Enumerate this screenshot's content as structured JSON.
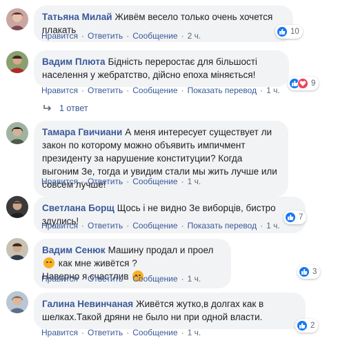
{
  "actions": {
    "like": "Нравится",
    "reply": "Ответить",
    "message": "Сообщение",
    "translate": "Показать перевод"
  },
  "colors": {
    "author": "#385898",
    "bubble": "#f2f3f5",
    "like": "#1877f2",
    "love": "#f33e58"
  },
  "comments": [
    {
      "author": "Татьяна Милай",
      "text": "Живём весело только очень хочется плакать",
      "time": "2 ч.",
      "reactions": "10"
    },
    {
      "author": "Вадим Плюта",
      "text": "Бідність переростає для більшості населення у жебратство, дійсно епоха міняється!",
      "time": "1 ч.",
      "reactions": "9"
    },
    {
      "author": "Тамара Гвичиани",
      "text": "А меня интересует существует ли закон по которому можно объявить импичмент президенту за нарушение конституции? Когда выгоним Зе, тогда и увидим стали мы жить лучше или совсем лучше!",
      "time": "1 ч."
    },
    {
      "author": "Светлана Борщ",
      "text": "Щось і не видно Зе виборців, бистро здулись!",
      "time": "1 ч.",
      "reactions": "7"
    },
    {
      "author": "Вадим Сенюк",
      "text_a": "Машину продал и проел",
      "text_b": "как мне живётся ?",
      "text_c": "Наверно я счастлив",
      "time": "1 ч.",
      "reactions": "3"
    },
    {
      "author": "Галина Невинчаная",
      "text": "Живётся жутко,в долгах как в шелках.Такой дряни не было ни при одной власти.",
      "time": "1 ч.",
      "reactions": "2"
    }
  ],
  "replies_label": "1 ответ"
}
